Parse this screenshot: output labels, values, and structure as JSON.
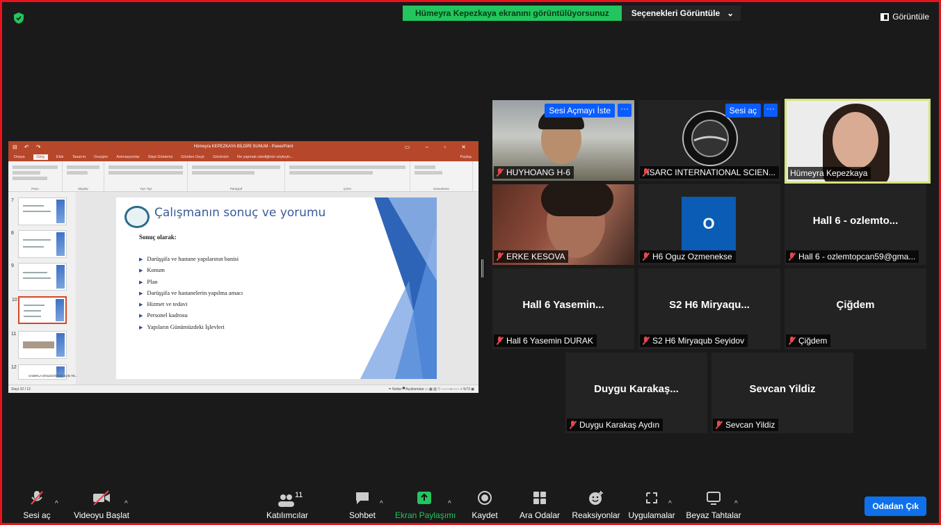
{
  "banner": {
    "sharing_text": "Hümeyra Kepezkaya ekranını görüntülüyorsunuz",
    "options_label": "Seçenekleri Görüntüle",
    "options_caret": "⌄"
  },
  "view_button": {
    "label": "Görüntüle"
  },
  "shared_screen": {
    "window_title": "Hümeyra KEPEZKAYA BİLDİRİ SUNUM - PowerPoint",
    "ribbon_tabs": [
      "Dosya",
      "Giriş",
      "Ekle",
      "Tasarım",
      "Geçişler",
      "Animasyonlar",
      "Slayt Gösterisi",
      "Gözden Geçir",
      "Görünüm",
      "Ne yapmak istediğinizi söyleyin...",
      "Paylaş"
    ],
    "ribbon_groups": [
      "Pano",
      "Slaytlar",
      "Yazı Tipi",
      "Paragraf",
      "Çizim",
      "Düzenleme"
    ],
    "thumb_numbers": [
      "7",
      "8",
      "9",
      "10",
      "11",
      "12"
    ],
    "thumb_caption": "SABIRLA DİNLEDİĞİNİZ İÇİN TE...",
    "slide_title": "Çalışmanın sonuç ve yorumu",
    "slide_subheading": "Sonuç olarak:",
    "slide_bullets": [
      "Darüşşifa ve hastane yapılarının banisi",
      "Konum",
      "Plan",
      "Darüşşifa ve hastanelerin yapılma amacı",
      "Hizmet ve tedavi",
      "Personel kadrosu",
      "Yapıların Günümüzdeki İşlevleri"
    ],
    "status_left": "Slayt 10 / 12",
    "status_right": "≐ Notlar   ▀ Açıklamalar   ▭  ▦  ▥  ▽  –——+——  + %73  ▣"
  },
  "participants": [
    {
      "name": "HUYHOANG H-6",
      "button": "Sesi Açmayı İste",
      "more": "···"
    },
    {
      "name": "ISARC INTERNATIONAL SCIEN...",
      "button": "Sesi aç",
      "more": "···"
    },
    {
      "name": "Hümeyra Kepezkaya"
    },
    {
      "name": "ERKE KESOVA"
    },
    {
      "name": "H6 Oguz Ozmenekse",
      "avatar": "O"
    },
    {
      "name": "Hall 6 - ozlemtopcan59@gma...",
      "display": "Hall 6 - ozlemto..."
    },
    {
      "name": "Hall 6 Yasemin DURAK",
      "display": "Hall 6 Yasemin..."
    },
    {
      "name": "S2 H6  Miryaqub Seyidov",
      "display": "S2 H6  Miryaqu..."
    },
    {
      "name": "Çiğdem",
      "display": "Çiğdem"
    },
    {
      "name": "Duygu Karakaş Aydın",
      "display": "Duygu  Karakaş..."
    },
    {
      "name": "Sevcan Yildiz",
      "display": "Sevcan Yildiz"
    }
  ],
  "toolbar": {
    "unmute": "Sesi aç",
    "start_video": "Videoyu Başlat",
    "participants": "Katılımcılar",
    "participants_count": "11",
    "chat": "Sohbet",
    "share": "Ekran Paylaşımı",
    "record": "Kaydet",
    "breakout": "Ara Odalar",
    "reactions": "Reaksiyonlar",
    "apps": "Uygulamalar",
    "whiteboards": "Beyaz Tahtalar",
    "leave": "Odadan Çık",
    "caret": "^"
  },
  "colors": {
    "frame_red": "#e8131b",
    "share_green": "#22c55e",
    "zoom_blue": "#0e71eb",
    "active_speaker": "#d7e37b",
    "ppt_orange": "#b7472a"
  }
}
